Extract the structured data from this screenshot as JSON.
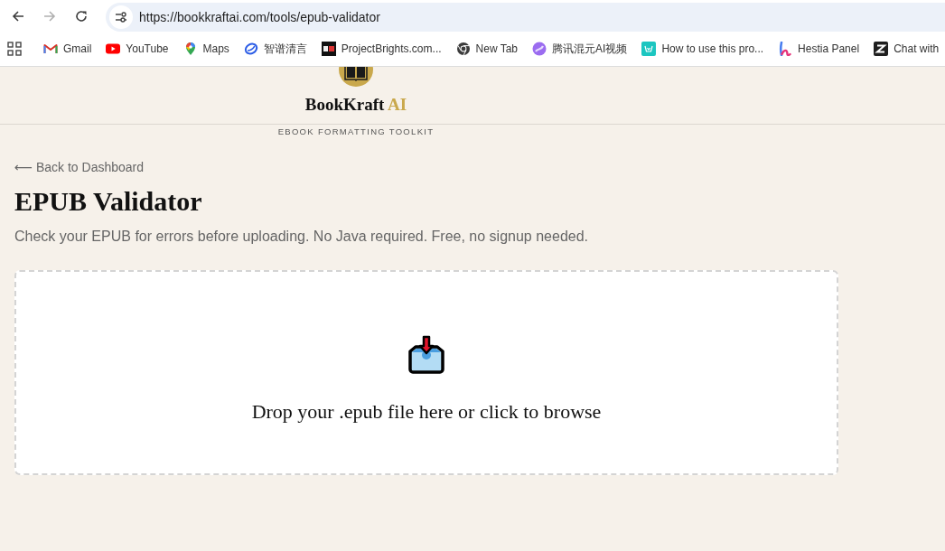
{
  "browser": {
    "nav_buttons": [
      {
        "kind": "back",
        "disabled": false
      },
      {
        "kind": "forward",
        "disabled": true
      },
      {
        "kind": "reload",
        "disabled": false
      }
    ],
    "address_bar": {
      "url": "https://bookkraftai.com/tools/epub-validator"
    },
    "bookmarks": [
      {
        "kind": "gmail",
        "label": "Gmail"
      },
      {
        "kind": "youtube",
        "label": "YouTube"
      },
      {
        "kind": "maps",
        "label": "Maps"
      },
      {
        "kind": "ring",
        "label": "智谱清言"
      },
      {
        "kind": "brg",
        "label": "ProjectBrights.com..."
      },
      {
        "kind": "chrome",
        "label": "New Tab"
      },
      {
        "kind": "orb",
        "label": "腾讯混元AI视频"
      },
      {
        "kind": "teal",
        "label": "How to use this pro..."
      },
      {
        "kind": "hestia",
        "label": "Hestia Panel"
      },
      {
        "kind": "zed",
        "label": "Chat with"
      }
    ]
  },
  "header": {
    "brand": {
      "name": "BookKraft",
      "accent": "AI"
    },
    "tagline": "EBOOK FORMATTING TOOLKIT"
  },
  "back_link": "⟵ Back to Dashboard",
  "title": "EPUB Validator",
  "subtitle": "Check your EPUB for errors before uploading. No Java required. Free, no signup needed.",
  "dropzone": {
    "prompt": "Drop your .epub file here or click to browse"
  }
}
